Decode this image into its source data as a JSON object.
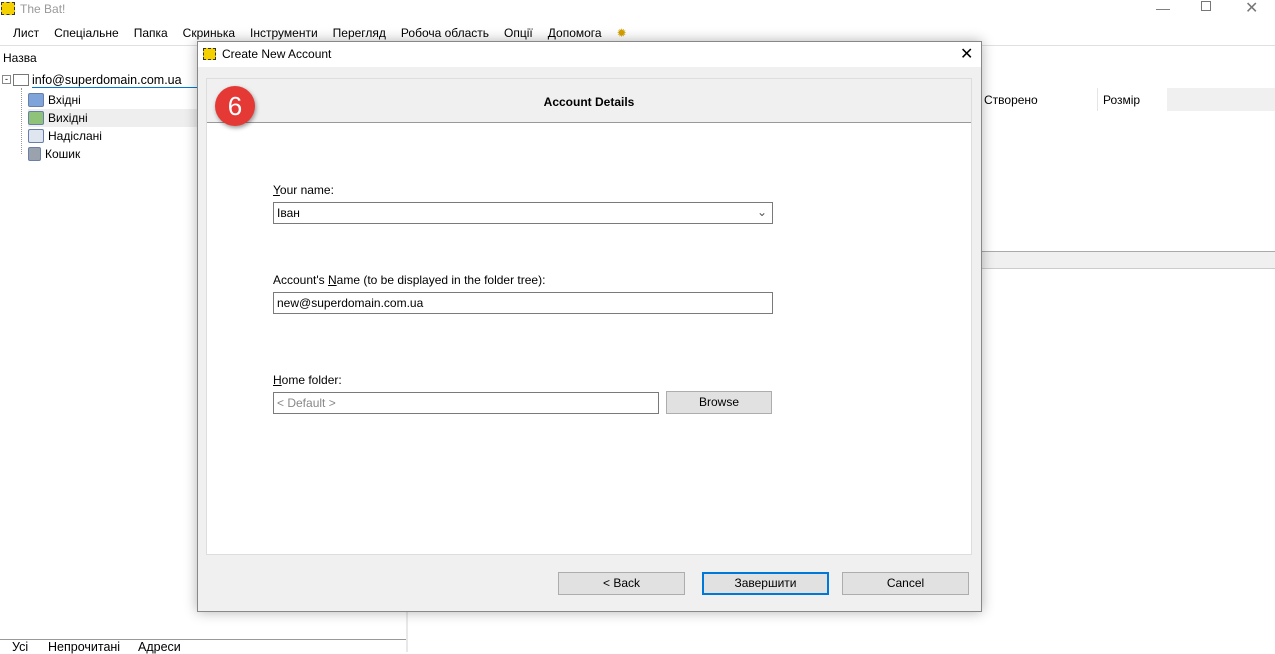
{
  "app": {
    "title": "The Bat!"
  },
  "menu": [
    "Лист",
    "Спеціальне",
    "Папка",
    "Скринька",
    "Інструменти",
    "Перегляд",
    "Робоча область",
    "Опції",
    "Допомога"
  ],
  "folder_pane": {
    "header": "Назва",
    "account": "info@superdomain.com.ua",
    "folders": [
      {
        "label": "Вхідні",
        "icon": "inbox-icon"
      },
      {
        "label": "Вихідні",
        "icon": "outbox-icon"
      },
      {
        "label": "Надіслані",
        "icon": "sent-icon"
      },
      {
        "label": "Кошик",
        "icon": "trash-icon"
      }
    ]
  },
  "message_list": {
    "columns": [
      "Створено",
      "Розмір"
    ]
  },
  "bottom_tabs": [
    "Усі",
    "Непрочитані",
    "Адреси"
  ],
  "dialog": {
    "title": "Create New Account",
    "step_badge": "6",
    "header": "Account Details",
    "your_name_label_u": "Y",
    "your_name_label": "our name:",
    "your_name_value": "Іван",
    "account_name_label_pre": "Account's ",
    "account_name_label_u": "N",
    "account_name_label_post": "ame (to be displayed in the folder tree):",
    "account_name_value": "new@superdomain.com.ua",
    "home_folder_label_u": "H",
    "home_folder_label": "ome folder:",
    "home_folder_placeholder": "< Default >",
    "browse": "Browse",
    "back": "<  Back",
    "finish": "Завершити",
    "cancel": "Cancel"
  },
  "colors": {
    "badge": "#e53935",
    "focus": "#0078d7"
  }
}
